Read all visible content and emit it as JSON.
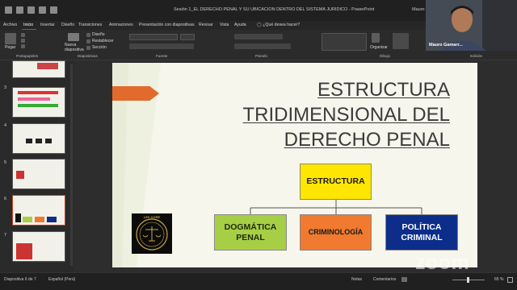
{
  "window": {
    "title": "Sesión 1_EL DERECHO PENAL Y SU UBICACION DENTRO DEL SISTEMA JURIDICO - PowerPoint",
    "user_short": "Mauro G"
  },
  "tabs": [
    "Archivo",
    "Inicio",
    "Insertar",
    "Diseño",
    "Transiciones",
    "Animaciones",
    "Presentación con diapositivas",
    "Revisar",
    "Vista",
    "Ayuda",
    "¿Qué desea hacer?"
  ],
  "ribbon": {
    "paste": "Pegar",
    "new_slide": "Nueva diapositiva",
    "design": "Diseño",
    "reset": "Restablecer",
    "section": "Sección",
    "arrange": "Organizar",
    "groups": [
      "Portapapeles",
      "Diapositivas",
      "Fuente",
      "Párrafo",
      "Dibujo",
      "Edición"
    ]
  },
  "slides": {
    "numbers": [
      "3",
      "4",
      "5",
      "6",
      "7"
    ],
    "selected": "6"
  },
  "slide": {
    "title_lines": [
      "ESTRUCTURA",
      "TRIDIMENSIONAL DEL",
      "DERECHO PENAL"
    ],
    "boxes": [
      {
        "label": "ESTRUCTURA",
        "bg": "#ffe600",
        "color": "#1a1a1a"
      },
      {
        "label": "DOGMÁTICA PENAL",
        "bg": "#a6cf45",
        "color": "#1f2b10"
      },
      {
        "label": "CRIMINOLOGÍA",
        "bg": "#ef7a30",
        "color": "#1a1a1a"
      },
      {
        "label": "POLÍTICA CRIMINAL",
        "bg": "#0c2e8a",
        "color": "#ffffff"
      }
    ],
    "logo_text_top": "LEX CORE",
    "accent": "#e26a2c"
  },
  "status": {
    "slide_info": "Diapositiva 6 de 7",
    "language": "Español (Perú)",
    "notes": "Notas",
    "comments": "Comentarios",
    "zoom": "65 %"
  },
  "camera": {
    "name": "Mauro Gamarr..."
  },
  "zoom_logo": "zoom"
}
